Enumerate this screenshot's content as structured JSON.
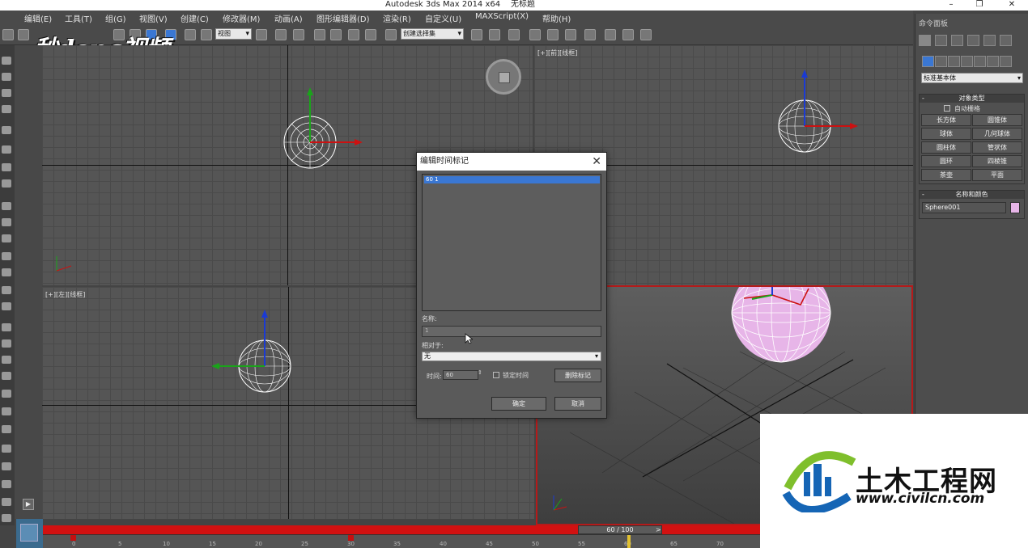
{
  "window": {
    "title": "Autodesk 3ds Max  2014 x64",
    "subtitle": "无标题",
    "minimize": "–",
    "restore": "❐",
    "close": "✕"
  },
  "menu": [
    {
      "id": "edit",
      "label": "编辑(E)"
    },
    {
      "id": "tools",
      "label": "工具(T)"
    },
    {
      "id": "group",
      "label": "组(G)"
    },
    {
      "id": "views",
      "label": "视图(V)"
    },
    {
      "id": "create",
      "label": "创建(C)"
    },
    {
      "id": "modifiers",
      "label": "修改器(M)"
    },
    {
      "id": "animation",
      "label": "动画(A)"
    },
    {
      "id": "graph-editors",
      "label": "图形编辑器(D)"
    },
    {
      "id": "rendering",
      "label": "渲染(R)"
    },
    {
      "id": "customize",
      "label": "自定义(U)"
    },
    {
      "id": "maxscript",
      "label": "MAXScript(X)"
    },
    {
      "id": "help",
      "label": "帮助(H)"
    }
  ],
  "toolbar": {
    "ref_coord": "视图",
    "selection_set": "创建选择集"
  },
  "watermark_top": "秒dong视频",
  "viewports": {
    "top_right_label": "[+][前][线框]",
    "bottom_left_label": "[+][左][线框]"
  },
  "command_panel": {
    "title": "命令面板",
    "category": "标准基本体",
    "object_type": {
      "header": "对象类型",
      "auto_grid": "自动栅格",
      "buttons": [
        "长方体",
        "圆锥体",
        "球体",
        "几何球体",
        "圆柱体",
        "管状体",
        "圆环",
        "四棱锥",
        "茶壶",
        "平面"
      ]
    },
    "name_color": {
      "header": "名称和颜色",
      "name": "Sphere001",
      "color": "#e7b5e8"
    }
  },
  "dialog": {
    "title": "编辑时间标记",
    "close": "✕",
    "list_items": [
      "60 1"
    ],
    "name_label": "名称:",
    "name_value": "1",
    "relative_label": "相对于:",
    "relative_value": "无",
    "time_label": "时间:",
    "time_value": "60",
    "lock_time": "锁定时间",
    "delete_mark": "删除标记",
    "ok": "确定",
    "cancel": "取消"
  },
  "timeline": {
    "slider": "60 / 100",
    "prev": "<",
    "next": ">",
    "ticks": [
      "0",
      "5",
      "10",
      "15",
      "20",
      "25",
      "30",
      "35",
      "40",
      "45",
      "50",
      "55",
      "60",
      "65",
      "70"
    ]
  },
  "watermark_bottom": {
    "name": "土木工程网",
    "url": "www.civilcn.com"
  },
  "colors": {
    "timebar": "#d21111",
    "selection": "#3a77d3"
  }
}
